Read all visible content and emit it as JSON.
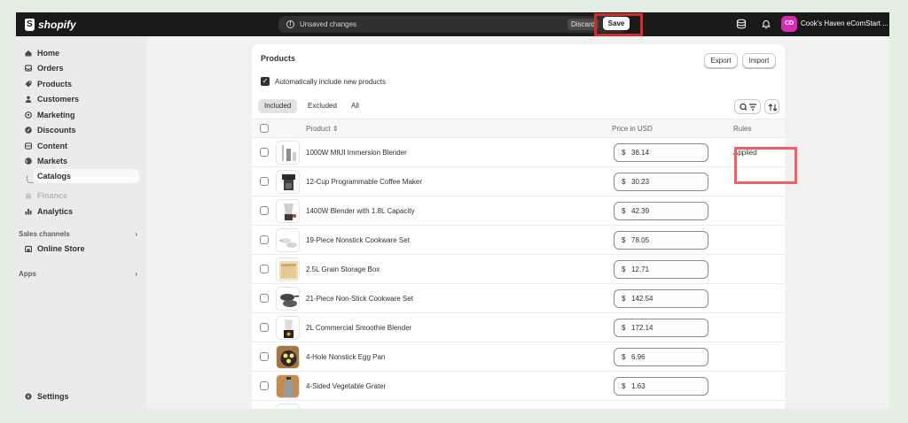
{
  "topbar": {
    "logo_text": "shopify",
    "unsaved_label": "Unsaved changes",
    "discard_label": "Discard",
    "save_label": "Save",
    "avatar_initials": "CD",
    "store_name": "Cook's Haven eComStart ..."
  },
  "sidebar": {
    "items": [
      {
        "label": "Home",
        "icon": "home-icon"
      },
      {
        "label": "Orders",
        "icon": "orders-icon"
      },
      {
        "label": "Products",
        "icon": "tag-icon"
      },
      {
        "label": "Customers",
        "icon": "person-icon"
      },
      {
        "label": "Marketing",
        "icon": "target-icon"
      },
      {
        "label": "Discounts",
        "icon": "discount-icon"
      },
      {
        "label": "Content",
        "icon": "content-icon"
      },
      {
        "label": "Markets",
        "icon": "globe-icon"
      },
      {
        "label": "Catalogs",
        "icon": "",
        "active": true
      },
      {
        "label": "Finance",
        "icon": "bank-icon",
        "disabled": true
      },
      {
        "label": "Analytics",
        "icon": "chart-icon"
      }
    ],
    "sales_channels_label": "Sales channels",
    "online_store_label": "Online Store",
    "apps_label": "Apps",
    "settings_label": "Settings"
  },
  "card": {
    "title": "Products",
    "export_label": "Export",
    "import_label": "Import",
    "auto_include_label": "Automatically include new products",
    "auto_include_checked": true,
    "tabs": [
      {
        "label": "Included",
        "active": true
      },
      {
        "label": "Excluded",
        "active": false
      },
      {
        "label": "All",
        "active": false
      }
    ],
    "columns": {
      "product": "Product",
      "price": "Price in USD",
      "rules": "Rules"
    },
    "currency_symbol": "$",
    "rows": [
      {
        "name": "1000W MIUI Immersion Blender",
        "price": "36.14",
        "rule": "Applied"
      },
      {
        "name": "12-Cup Programmable Coffee Maker",
        "price": "30.23",
        "rule": ""
      },
      {
        "name": "1400W Blender with 1.8L Capacity",
        "price": "42.39",
        "rule": ""
      },
      {
        "name": "19-Piece Nonstick Cookware Set",
        "price": "78.05",
        "rule": ""
      },
      {
        "name": "2.5L Grain Storage Box",
        "price": "12.71",
        "rule": ""
      },
      {
        "name": "21-Piece Non-Stick Cookware Set",
        "price": "142.54",
        "rule": ""
      },
      {
        "name": "2L Commercial Smoothie Blender",
        "price": "172.14",
        "rule": ""
      },
      {
        "name": "4-Hole Nonstick Egg Pan",
        "price": "6.96",
        "rule": ""
      },
      {
        "name": "4-Sided Vegetable Grater",
        "price": "1.63",
        "rule": ""
      }
    ]
  },
  "colors": {
    "topbar_bg": "#1a1a1a",
    "highlight_save": "#d52b2b",
    "highlight_rules": "#f0606a",
    "avatar_bg": "#d42fb3",
    "page_bg": "#e3efe3"
  }
}
